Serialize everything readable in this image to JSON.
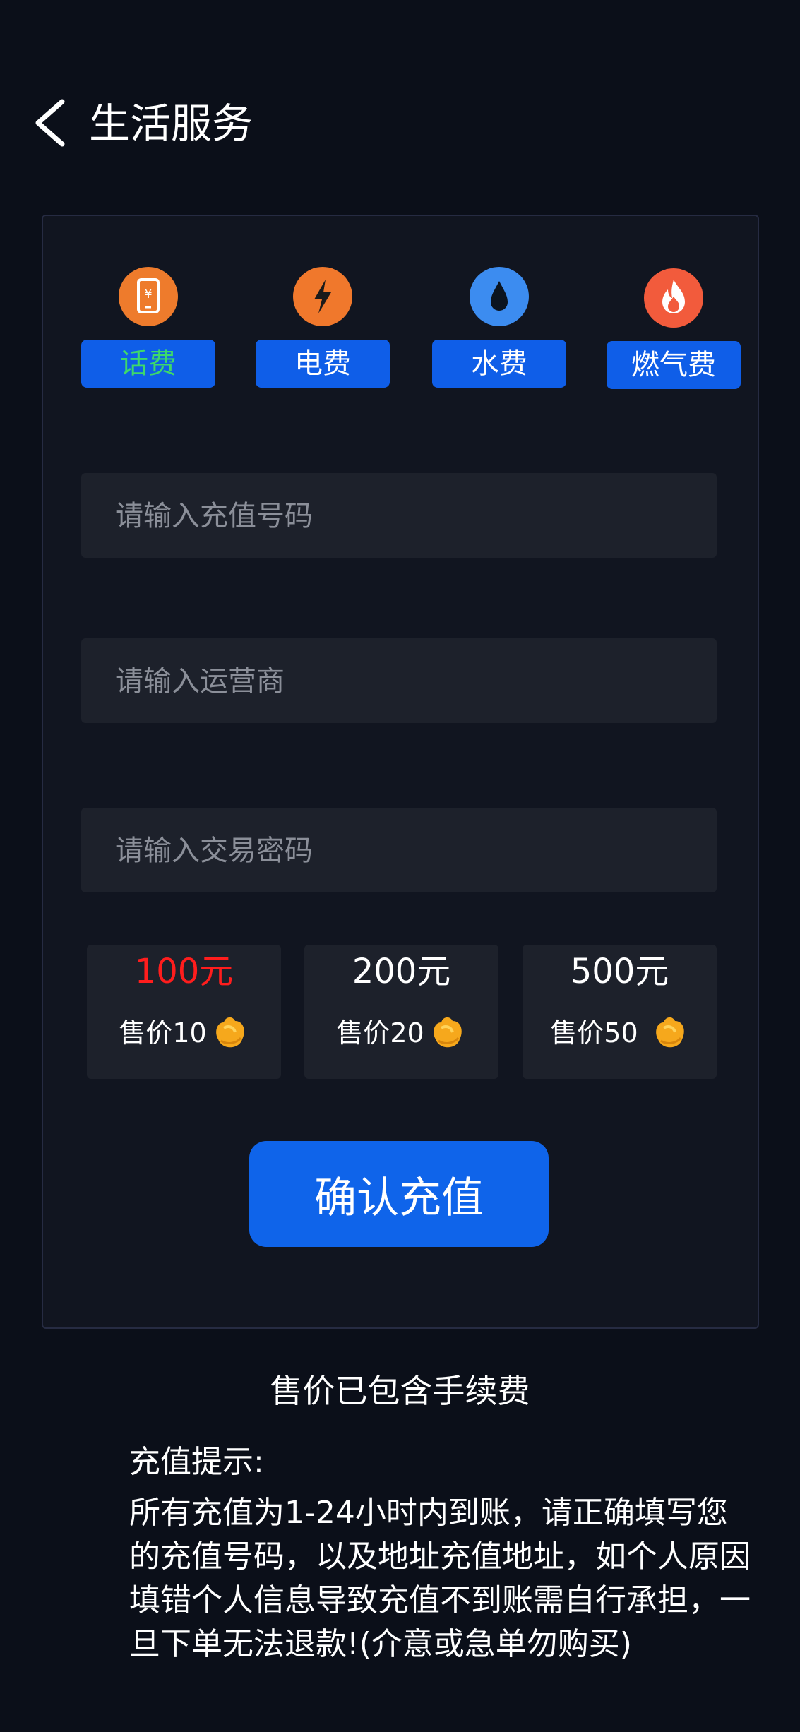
{
  "header": {
    "title": "生活服务",
    "back_icon": "chevron-left-icon"
  },
  "services": [
    {
      "label": "话费",
      "icon": "phone-yuan-icon",
      "icon_color": "#ee7b2c",
      "active": true
    },
    {
      "label": "电费",
      "icon": "lightning-icon",
      "icon_color": "#f0782c",
      "active": false
    },
    {
      "label": "水费",
      "icon": "water-drop-icon",
      "icon_color": "#3c8cf0",
      "active": false
    },
    {
      "label": "燃气费",
      "icon": "flame-icon",
      "icon_color": "#f25b3c",
      "active": false
    }
  ],
  "form": {
    "phone_placeholder": "请输入充值号码",
    "operator_placeholder": "请输入运营商",
    "password_placeholder": "请输入交易密码"
  },
  "amounts": [
    {
      "value": "100元",
      "price_text": "售价10",
      "selected": true
    },
    {
      "value": "200元",
      "price_text": "售价20",
      "selected": false
    },
    {
      "value": "500元",
      "price_text": "售价50",
      "selected": false
    }
  ],
  "price_icon": "gold-coin-icon",
  "confirm_label": "确认充值",
  "fee_note": "售价已包含手续费",
  "tips": {
    "title": "充值提示:",
    "body": "所有充值为1-24小时内到账，请正确填写您的充值号码，以及地址充值地址，如个人原因填错个人信息导致充值不到账需自行承担，一旦下单无法退款!(介意或急单勿购买)"
  },
  "colors": {
    "background": "#0b0f19",
    "card": "#111520",
    "accent_blue": "#0f64ea",
    "active_green": "#3ed96a",
    "selected_red": "#ff1d1d",
    "input_bg": "#1d212b"
  }
}
